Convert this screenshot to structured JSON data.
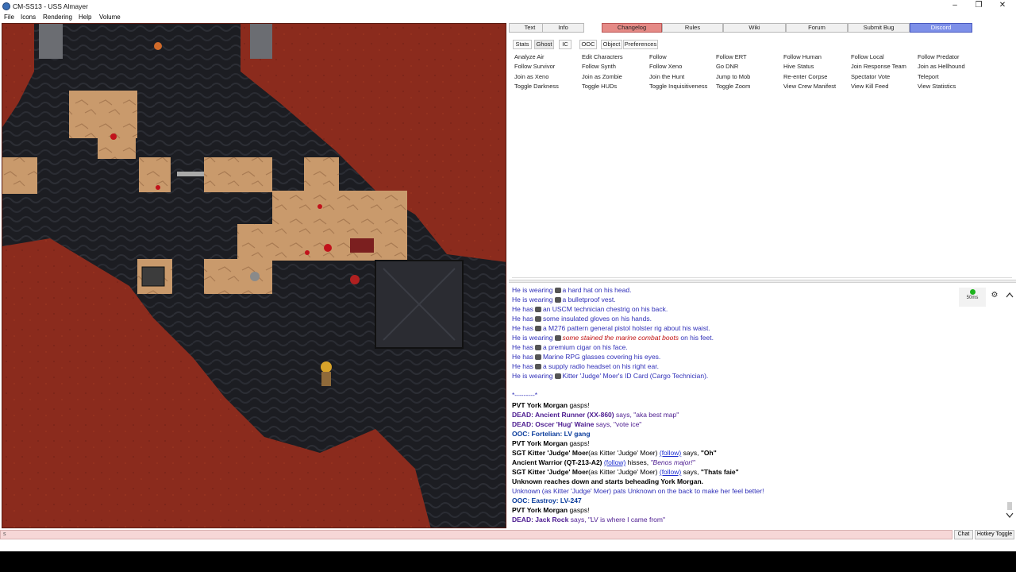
{
  "window": {
    "title": "CM-SS13 - USS Almayer"
  },
  "menu": [
    "File",
    "Icons",
    "Rendering",
    "Help",
    "Volume"
  ],
  "top_buttons": [
    "Text",
    "Info",
    "Changelog",
    "Rules",
    "Wiki",
    "Forum",
    "Submit Bug",
    "Discord"
  ],
  "sub_tabs": [
    "Stats",
    "Ghost",
    "IC",
    "OOC",
    "Object",
    "Preferences"
  ],
  "verbs": [
    [
      "Analyze Air",
      "Edit Characters",
      "Follow",
      "Follow ERT",
      "Follow Human",
      "Follow Local",
      "Follow Predator"
    ],
    [
      "Follow Survivor",
      "Follow Synth",
      "Follow Xeno",
      "Go DNR",
      "Hive Status",
      "Join Response Team",
      "Join as Hellhound"
    ],
    [
      "Join as Xeno",
      "Join as Zombie",
      "Join the Hunt",
      "Jump to Mob",
      "Re-enter Corpse",
      "Spectator Vote",
      "Teleport"
    ],
    [
      "Toggle Darkness",
      "Toggle HUDs",
      "Toggle Inquisitiveness",
      "Toggle Zoom",
      "View Crew Manifest",
      "View Kill Feed",
      "View Statistics"
    ]
  ],
  "chat": {
    "examine": [
      {
        "pre": "He is wearing",
        "text": "a hard hat on his head."
      },
      {
        "pre": "He is wearing",
        "text": "a bulletproof vest."
      },
      {
        "pre": "He has",
        "text": "an USCM technician chestrig on his back."
      },
      {
        "pre": "He has",
        "text": "some insulated gloves on his hands."
      },
      {
        "pre": "He has",
        "text": "a M276 pattern general pistol holster rig about his waist."
      },
      {
        "pre": "He is wearing",
        "text": "some stained the marine combat boots",
        "post": "on his feet."
      },
      {
        "pre": "He has",
        "text": "a premium cigar on his face."
      },
      {
        "pre": "He has",
        "text": "Marine RPG glasses covering his eyes."
      },
      {
        "pre": "He has",
        "text": "a supply radio headset on his right ear."
      },
      {
        "pre": "He is wearing",
        "text": "Kitter 'Judge' Moer's ID Card (Cargo Technician)."
      }
    ],
    "separator": "*---------*",
    "l1_name": "PVT York Morgan",
    "l1_text": "gasps!",
    "l2_name": "DEAD: Ancient Runner (XX-860)",
    "l2_says": "says,",
    "l2_quote": "\"aka best map\"",
    "l3_name": "DEAD: Oscer 'Hug' Waine",
    "l3_says": "says,",
    "l3_quote": "\"vote ice\"",
    "l4_text": "OOC: Fortelian: LV gang",
    "l5_name": "PVT York Morgan",
    "l5_text": "gasps!",
    "l6_name": "SGT Kitter 'Judge' Moer",
    "l6_as": "(as Kitter 'Judge' Moer)",
    "l6_link": "(follow)",
    "l6_says": "says,",
    "l6_quote": "\"Oh\"",
    "l7_name": "Ancient Warrior (QT-213-A2)",
    "l7_link": "(follow)",
    "l7_says": "hisses,",
    "l7_quote": "\"Benos major!\"",
    "l8_name": "SGT Kitter 'Judge' Moer",
    "l8_as": "(as Kitter 'Judge' Moer)",
    "l8_link": "(follow)",
    "l8_says": "says,",
    "l8_quote": "\"Thats faie\"",
    "l9_text": "Unknown reaches down and starts beheading York Morgan.",
    "l10_text": "Unknown (as Kitter 'Judge' Moer) pats Unknown on the back to make her feel better!",
    "l11_text": "OOC: Eastroy: LV-247",
    "l12_name": "PVT York Morgan",
    "l12_text": "gasps!",
    "l13_name": "DEAD: Jack Rock",
    "l13_says": "says,",
    "l13_quote": "\"LV is where I came from\""
  },
  "ping": "50ms",
  "input": {
    "value": "s"
  },
  "bottom_buttons": {
    "chat": "Chat",
    "hotkey": "Hotkey Toggle"
  }
}
